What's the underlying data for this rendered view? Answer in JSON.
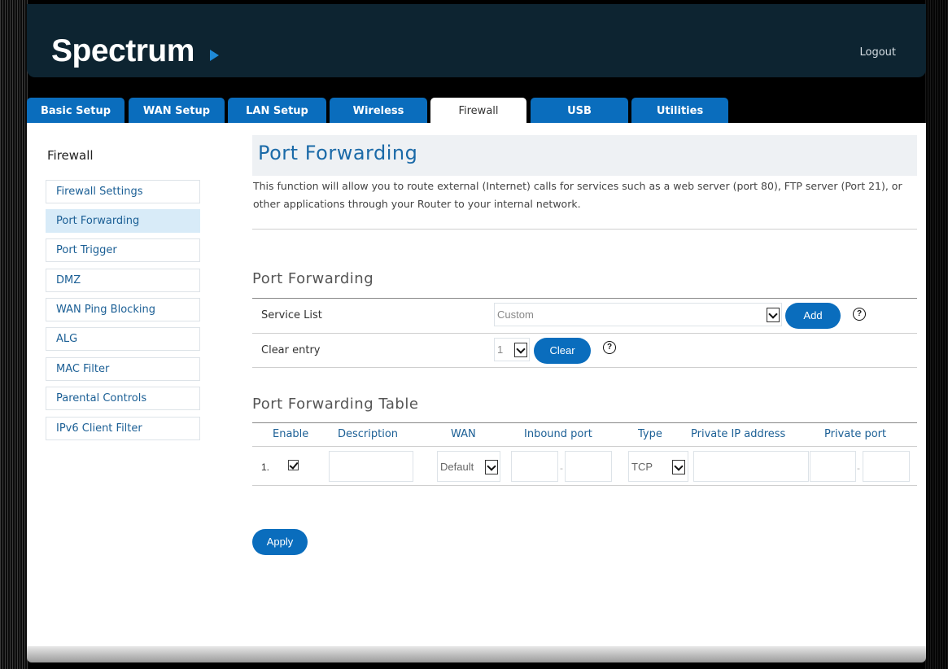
{
  "header": {
    "logo_text": "Spectrum",
    "logout_label": "Logout"
  },
  "tabs": [
    "Basic Setup",
    "WAN Setup",
    "LAN Setup",
    "Wireless",
    "Firewall",
    "USB",
    "Utilities"
  ],
  "active_tab": "Firewall",
  "sidebar": {
    "title": "Firewall",
    "items": [
      "Firewall Settings",
      "Port Forwarding",
      "Port Trigger",
      "DMZ",
      "WAN Ping Blocking",
      "ALG",
      "MAC Filter",
      "Parental Controls",
      "IPv6 Client Filter"
    ],
    "active": "Port Forwarding"
  },
  "main": {
    "page_title": "Port Forwarding",
    "description": "This function will allow you to route external (Internet) calls for services such as a web server (port 80), FTP server (Port 21), or other applications through your Router to your internal network.",
    "section_title": "Port Forwarding",
    "service_list": {
      "label": "Service List",
      "value": "Custom",
      "add_label": "Add",
      "help": "?"
    },
    "clear_entry": {
      "label": "Clear entry",
      "value": "1",
      "clear_label": "Clear",
      "help": "?"
    },
    "table": {
      "title": "Port Forwarding Table",
      "headers": [
        "Enable",
        "Description",
        "WAN",
        "Inbound port",
        "Type",
        "Private IP address",
        "Private port"
      ],
      "rows": [
        {
          "index": "1.",
          "enabled": true,
          "description": "",
          "wan": "Default",
          "inbound_start": "",
          "inbound_end": "",
          "type": "TCP",
          "private_ip": "",
          "private_start": "",
          "private_end": "",
          "separator": "-"
        }
      ]
    },
    "apply_label": "Apply"
  },
  "colors": {
    "header_bg": "#0d2431",
    "tab_blue": "#0a6dbd",
    "link_blue": "#1b5f95",
    "active_sidebar_bg": "#d8ebf8"
  }
}
